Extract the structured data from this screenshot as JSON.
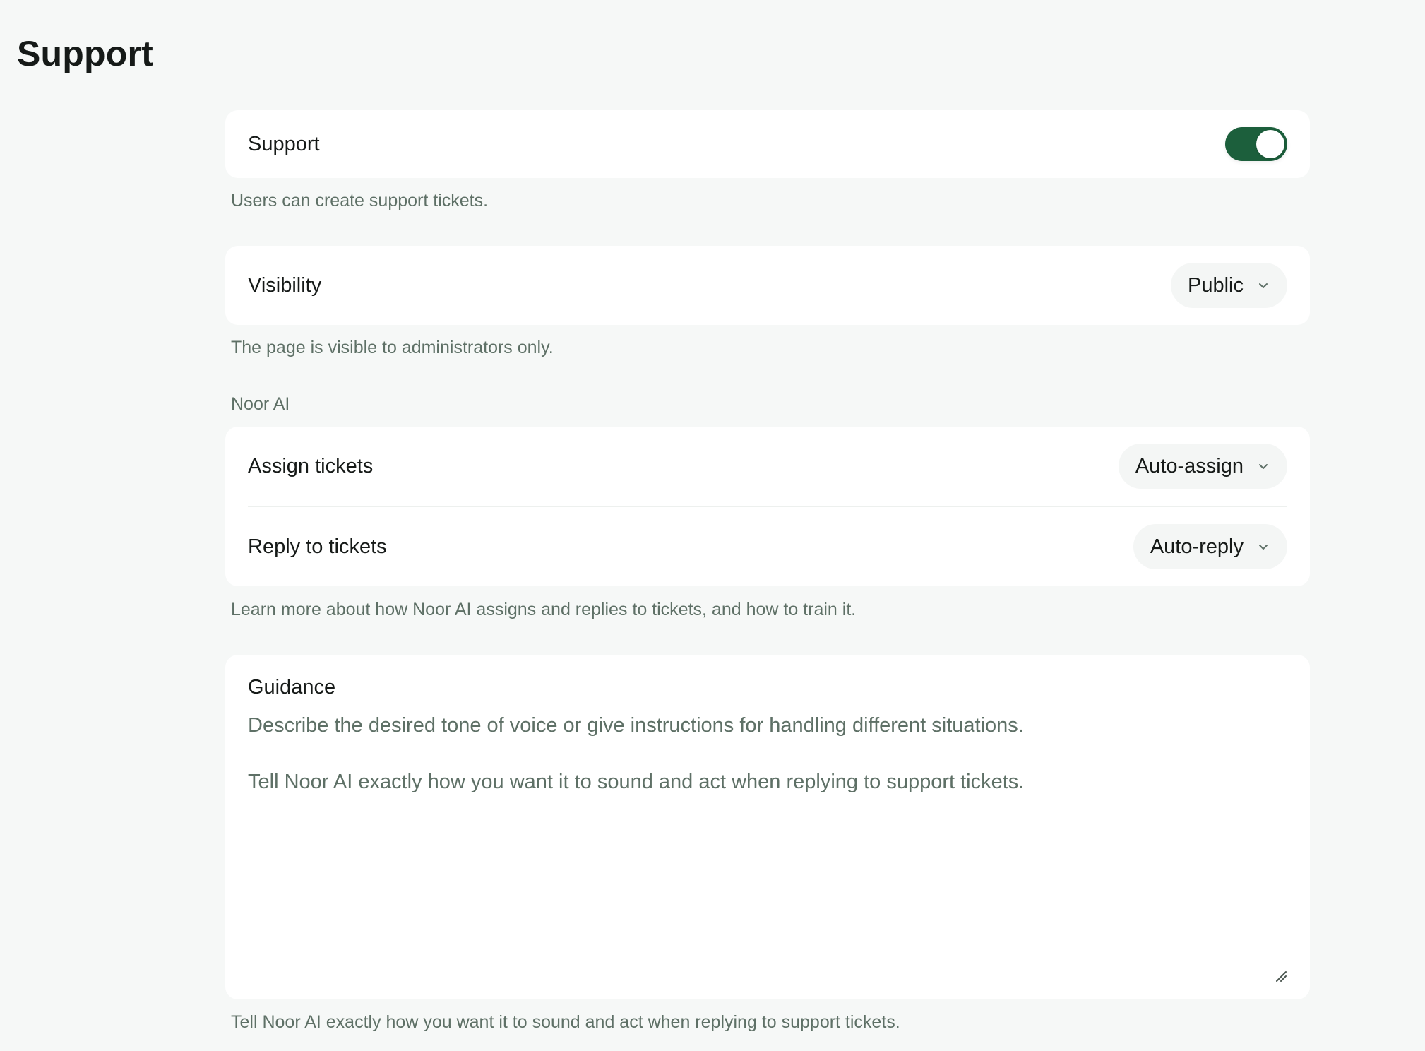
{
  "page": {
    "title": "Support"
  },
  "support": {
    "label": "Support",
    "enabled": true,
    "help": "Users can create support tickets."
  },
  "visibility": {
    "label": "Visibility",
    "value": "Public",
    "help": "The page is visible to administrators only."
  },
  "noor_ai": {
    "section_label": "Noor AI",
    "assign": {
      "label": "Assign tickets",
      "value": "Auto-assign"
    },
    "reply": {
      "label": "Reply to tickets",
      "value": "Auto-reply"
    },
    "help": "Learn more about how Noor AI assigns and replies to tickets, and how to train it."
  },
  "guidance": {
    "label": "Guidance",
    "placeholder": "Describe the desired tone of voice or give instructions for handling different situations.\n\nTell Noor AI exactly how you want it to sound and act when replying to support tickets.",
    "help": "Tell Noor AI exactly how you want it to sound and act when replying to support tickets."
  },
  "colors": {
    "accent": "#1c5f3c",
    "background": "#f6f8f7",
    "muted_text": "#5e7066"
  },
  "icons": {
    "dropdown": "chevron-down-icon",
    "resize": "resize-handle-icon"
  }
}
